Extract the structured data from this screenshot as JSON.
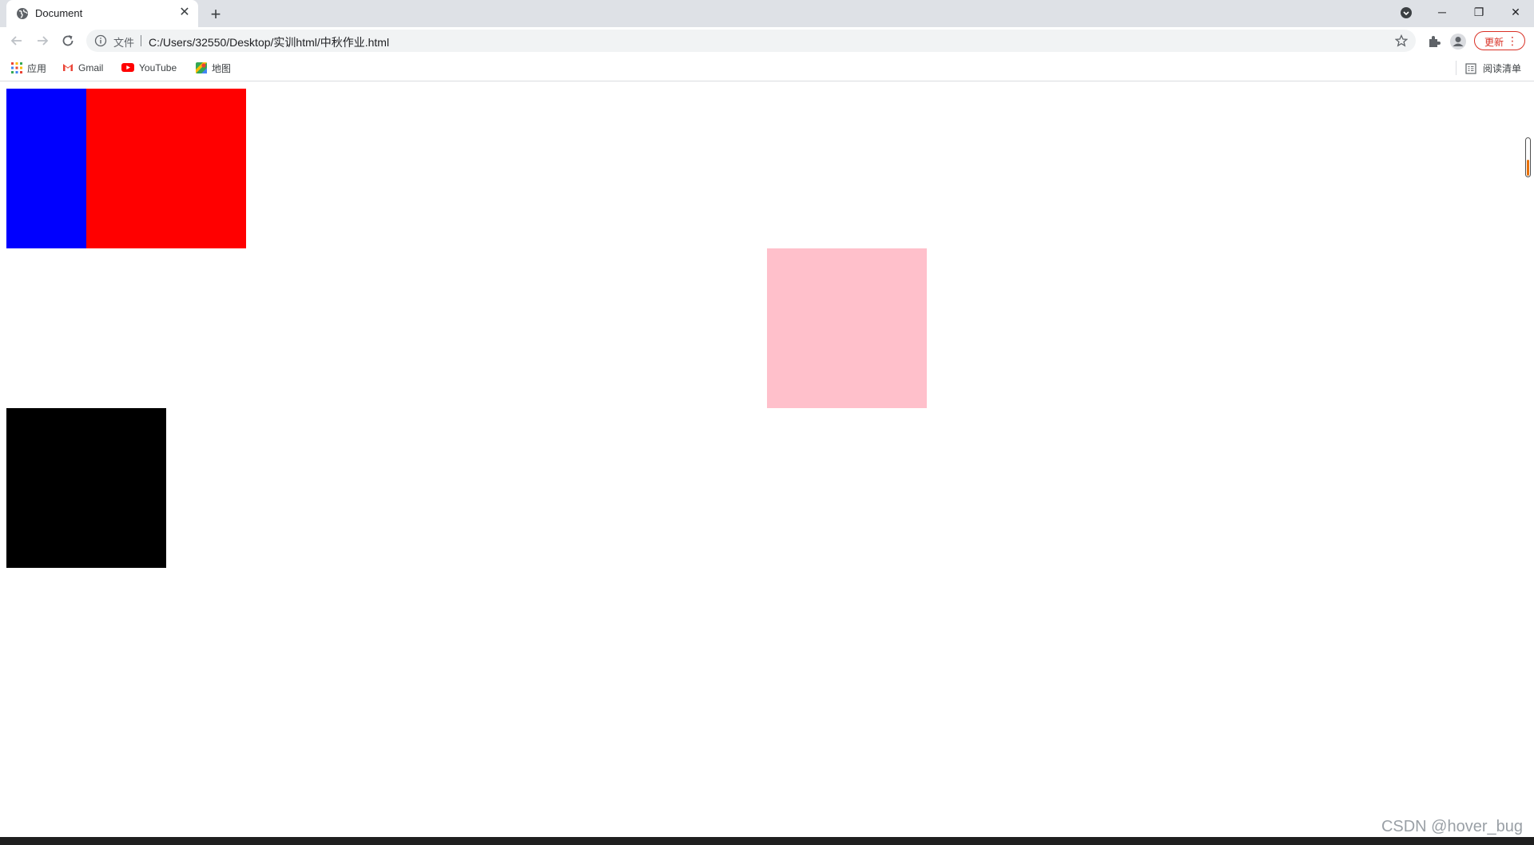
{
  "browser": {
    "tab": {
      "title": "Document",
      "close_glyph": "✕",
      "favicon": "globe-icon"
    },
    "new_tab_glyph": "+",
    "window_controls": {
      "minimize": "─",
      "maximize": "❐",
      "close": "✕"
    },
    "toolbar": {
      "scheme_label": "文件",
      "url": "C:/Users/32550/Desktop/实训html/中秋作业.html",
      "update_label": "更新",
      "menu_glyph": "⋮"
    },
    "bookmarks": [
      {
        "label": "应用",
        "icon": "apps-grid-icon"
      },
      {
        "label": "Gmail",
        "icon": "gmail-icon"
      },
      {
        "label": "YouTube",
        "icon": "youtube-icon"
      },
      {
        "label": "地图",
        "icon": "maps-icon"
      }
    ],
    "reading_list_label": "阅读清单"
  },
  "page": {
    "boxes": [
      {
        "name": "red-box",
        "color": "#ff0000"
      },
      {
        "name": "blue-box",
        "color": "#0000ff"
      },
      {
        "name": "pink-box",
        "color": "#ffc0cb"
      },
      {
        "name": "black-box",
        "color": "#000000"
      }
    ]
  },
  "watermark": "CSDN @hover_bug"
}
